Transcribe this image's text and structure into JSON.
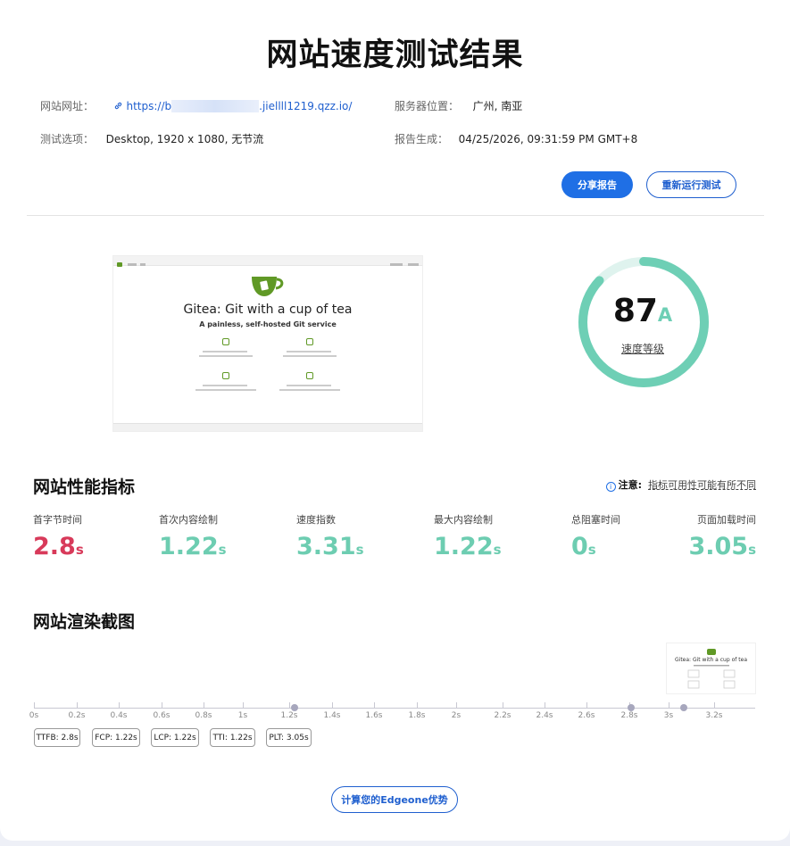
{
  "title": "网站速度测试结果",
  "info": {
    "url_label": "网站网址：",
    "url_prefix": "https://b",
    "url_suffix": ".jiellll1219.qzz.io/",
    "server_label": "服务器位置：",
    "server_value": "广州, 南亚",
    "options_label": "测试选项：",
    "options_value": "Desktop, 1920 x 1080, 无节流",
    "report_label": "报告生成：",
    "report_value": "04/25/2026, 09:31:59 PM GMT+8"
  },
  "buttons": {
    "share": "分享报告",
    "rerun": "重新运行测试",
    "calc": "计算您的Edgeone优势"
  },
  "preview": {
    "headline": "Gitea: Git with a cup of tea",
    "subline": "A painless, self-hosted Git service"
  },
  "score": {
    "value": "87",
    "grade": "A",
    "label": "速度等级",
    "percent": 87,
    "ring_color": "#6ecfb5",
    "track_color": "#dff3ee"
  },
  "performance": {
    "title": "网站性能指标",
    "note_label": "注意:",
    "note_text": "指标可用性可能有所不同",
    "metrics": [
      {
        "label": "首字节时间",
        "value": "2.8",
        "unit": "s",
        "color": "#d83a5a"
      },
      {
        "label": "首次内容绘制",
        "value": "1.22",
        "unit": "s",
        "color": "#6dcdb1"
      },
      {
        "label": "速度指数",
        "value": "3.31",
        "unit": "s",
        "color": "#6dcdb1"
      },
      {
        "label": "最大内容绘制",
        "value": "1.22",
        "unit": "s",
        "color": "#6dcdb1"
      },
      {
        "label": "总阻塞时间",
        "value": "0",
        "unit": "s",
        "color": "#6dcdb1"
      },
      {
        "label": "页面加载时间",
        "value": "3.05",
        "unit": "s",
        "color": "#6dcdb1"
      }
    ]
  },
  "filmstrip": {
    "title": "网站渲染截图",
    "ticks": [
      "0s",
      "0.2s",
      "0.4s",
      "0.6s",
      "0.8s",
      "1s",
      "1.2s",
      "1.4s",
      "1.6s",
      "1.8s",
      "2s",
      "2.2s",
      "2.4s",
      "2.6s",
      "2.8s",
      "3s",
      "3.2s"
    ],
    "frame_caption": "Gitea: Git with a cup of tea",
    "markers": [
      "TTFB: 2.8s",
      "FCP: 1.22s",
      "LCP: 1.22s",
      "TTI: 1.22s",
      "PLT: 3.05s"
    ]
  }
}
